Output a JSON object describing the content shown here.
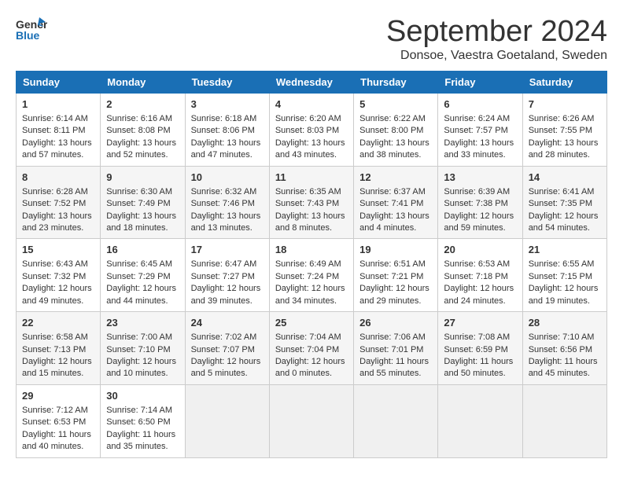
{
  "header": {
    "logo_line1": "General",
    "logo_line2": "Blue",
    "title": "September 2024",
    "subtitle": "Donsoe, Vaestra Goetaland, Sweden"
  },
  "columns": [
    "Sunday",
    "Monday",
    "Tuesday",
    "Wednesday",
    "Thursday",
    "Friday",
    "Saturday"
  ],
  "weeks": [
    [
      {
        "day": "1",
        "info": "Sunrise: 6:14 AM\nSunset: 8:11 PM\nDaylight: 13 hours\nand 57 minutes."
      },
      {
        "day": "2",
        "info": "Sunrise: 6:16 AM\nSunset: 8:08 PM\nDaylight: 13 hours\nand 52 minutes."
      },
      {
        "day": "3",
        "info": "Sunrise: 6:18 AM\nSunset: 8:06 PM\nDaylight: 13 hours\nand 47 minutes."
      },
      {
        "day": "4",
        "info": "Sunrise: 6:20 AM\nSunset: 8:03 PM\nDaylight: 13 hours\nand 43 minutes."
      },
      {
        "day": "5",
        "info": "Sunrise: 6:22 AM\nSunset: 8:00 PM\nDaylight: 13 hours\nand 38 minutes."
      },
      {
        "day": "6",
        "info": "Sunrise: 6:24 AM\nSunset: 7:57 PM\nDaylight: 13 hours\nand 33 minutes."
      },
      {
        "day": "7",
        "info": "Sunrise: 6:26 AM\nSunset: 7:55 PM\nDaylight: 13 hours\nand 28 minutes."
      }
    ],
    [
      {
        "day": "8",
        "info": "Sunrise: 6:28 AM\nSunset: 7:52 PM\nDaylight: 13 hours\nand 23 minutes."
      },
      {
        "day": "9",
        "info": "Sunrise: 6:30 AM\nSunset: 7:49 PM\nDaylight: 13 hours\nand 18 minutes."
      },
      {
        "day": "10",
        "info": "Sunrise: 6:32 AM\nSunset: 7:46 PM\nDaylight: 13 hours\nand 13 minutes."
      },
      {
        "day": "11",
        "info": "Sunrise: 6:35 AM\nSunset: 7:43 PM\nDaylight: 13 hours\nand 8 minutes."
      },
      {
        "day": "12",
        "info": "Sunrise: 6:37 AM\nSunset: 7:41 PM\nDaylight: 13 hours\nand 4 minutes."
      },
      {
        "day": "13",
        "info": "Sunrise: 6:39 AM\nSunset: 7:38 PM\nDaylight: 12 hours\nand 59 minutes."
      },
      {
        "day": "14",
        "info": "Sunrise: 6:41 AM\nSunset: 7:35 PM\nDaylight: 12 hours\nand 54 minutes."
      }
    ],
    [
      {
        "day": "15",
        "info": "Sunrise: 6:43 AM\nSunset: 7:32 PM\nDaylight: 12 hours\nand 49 minutes."
      },
      {
        "day": "16",
        "info": "Sunrise: 6:45 AM\nSunset: 7:29 PM\nDaylight: 12 hours\nand 44 minutes."
      },
      {
        "day": "17",
        "info": "Sunrise: 6:47 AM\nSunset: 7:27 PM\nDaylight: 12 hours\nand 39 minutes."
      },
      {
        "day": "18",
        "info": "Sunrise: 6:49 AM\nSunset: 7:24 PM\nDaylight: 12 hours\nand 34 minutes."
      },
      {
        "day": "19",
        "info": "Sunrise: 6:51 AM\nSunset: 7:21 PM\nDaylight: 12 hours\nand 29 minutes."
      },
      {
        "day": "20",
        "info": "Sunrise: 6:53 AM\nSunset: 7:18 PM\nDaylight: 12 hours\nand 24 minutes."
      },
      {
        "day": "21",
        "info": "Sunrise: 6:55 AM\nSunset: 7:15 PM\nDaylight: 12 hours\nand 19 minutes."
      }
    ],
    [
      {
        "day": "22",
        "info": "Sunrise: 6:58 AM\nSunset: 7:13 PM\nDaylight: 12 hours\nand 15 minutes."
      },
      {
        "day": "23",
        "info": "Sunrise: 7:00 AM\nSunset: 7:10 PM\nDaylight: 12 hours\nand 10 minutes."
      },
      {
        "day": "24",
        "info": "Sunrise: 7:02 AM\nSunset: 7:07 PM\nDaylight: 12 hours\nand 5 minutes."
      },
      {
        "day": "25",
        "info": "Sunrise: 7:04 AM\nSunset: 7:04 PM\nDaylight: 12 hours\nand 0 minutes."
      },
      {
        "day": "26",
        "info": "Sunrise: 7:06 AM\nSunset: 7:01 PM\nDaylight: 11 hours\nand 55 minutes."
      },
      {
        "day": "27",
        "info": "Sunrise: 7:08 AM\nSunset: 6:59 PM\nDaylight: 11 hours\nand 50 minutes."
      },
      {
        "day": "28",
        "info": "Sunrise: 7:10 AM\nSunset: 6:56 PM\nDaylight: 11 hours\nand 45 minutes."
      }
    ],
    [
      {
        "day": "29",
        "info": "Sunrise: 7:12 AM\nSunset: 6:53 PM\nDaylight: 11 hours\nand 40 minutes."
      },
      {
        "day": "30",
        "info": "Sunrise: 7:14 AM\nSunset: 6:50 PM\nDaylight: 11 hours\nand 35 minutes."
      },
      {
        "day": "",
        "info": ""
      },
      {
        "day": "",
        "info": ""
      },
      {
        "day": "",
        "info": ""
      },
      {
        "day": "",
        "info": ""
      },
      {
        "day": "",
        "info": ""
      }
    ]
  ]
}
